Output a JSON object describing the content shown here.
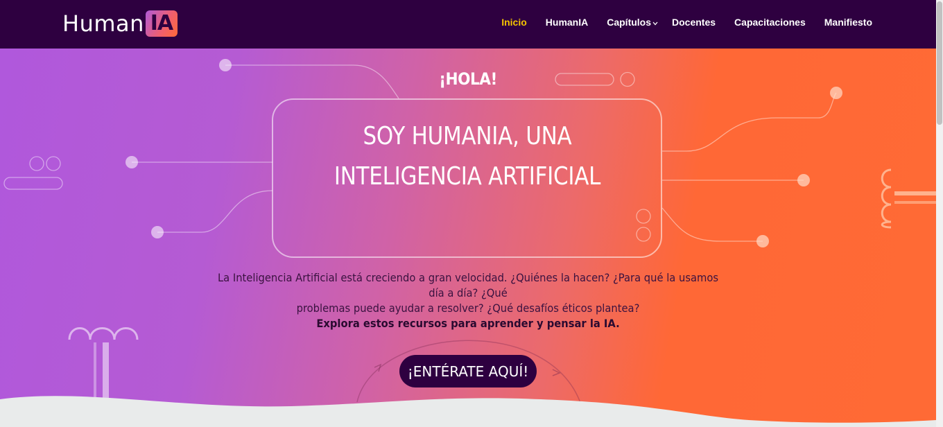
{
  "header": {
    "logo_text": "Human",
    "logo_badge": "IA",
    "menu": [
      {
        "label": "Inicio",
        "active": true
      },
      {
        "label": "HumanIA",
        "active": false
      },
      {
        "label": "Capítulos",
        "active": false,
        "has_dropdown": true
      },
      {
        "label": "Docentes",
        "active": false
      },
      {
        "label": "Capacitaciones",
        "active": false
      },
      {
        "label": "Manifiesto",
        "active": false
      }
    ]
  },
  "hero": {
    "greeting": "¡HOLA!",
    "headline_line1": "SOY HUMANIA, UNA",
    "headline_line2": "INTELIGENCIA ARTIFICIAL",
    "intro_line1": "La Inteligencia Artificial está creciendo a gran velocidad. ¿Quiénes la hacen? ¿Para qué la usamos día a día? ¿Qué",
    "intro_line2": "problemas puede ayudar a resolver? ¿Qué desafíos éticos plantea?",
    "intro_bold": "Explora estos recursos para aprender y pensar la IA.",
    "cta_label": "¡ENTÉRATE AQUÍ!"
  },
  "colors": {
    "nav_bg": "#2e0040",
    "active_link": "#f5c400",
    "gradient_start": "#b058dc",
    "gradient_end": "#ff6a35",
    "cta_bg": "#2e0040"
  },
  "icons": [
    "chevron-down-icon"
  ]
}
